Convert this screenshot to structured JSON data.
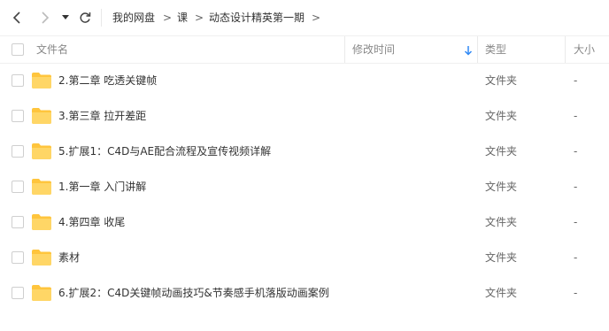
{
  "breadcrumb": {
    "items": [
      "我的网盘",
      "课",
      "动态设计精英第一期"
    ],
    "separator": ">"
  },
  "table": {
    "headers": {
      "name": "文件名",
      "modified": "修改时间",
      "type": "类型",
      "size": "大小"
    },
    "sort_icon": "sort-desc-arrow-icon",
    "rows": [
      {
        "name": "2.第二章 吃透关键帧",
        "type": "文件夹",
        "size": "-"
      },
      {
        "name": "3.第三章 拉开差距",
        "type": "文件夹",
        "size": "-"
      },
      {
        "name": "5.扩展1：C4D与AE配合流程及宣传视频详解",
        "type": "文件夹",
        "size": "-"
      },
      {
        "name": "1.第一章 入门讲解",
        "type": "文件夹",
        "size": "-"
      },
      {
        "name": "4.第四章 收尾",
        "type": "文件夹",
        "size": "-"
      },
      {
        "name": "素材",
        "type": "文件夹",
        "size": "-"
      },
      {
        "name": "6.扩展2：C4D关键帧动画技巧&节奏感手机落版动画案例",
        "type": "文件夹",
        "size": "-"
      }
    ]
  },
  "colors": {
    "folder": "#FFC53D",
    "accent": "#2f88f5",
    "text": "#333333",
    "muted": "#888888"
  }
}
